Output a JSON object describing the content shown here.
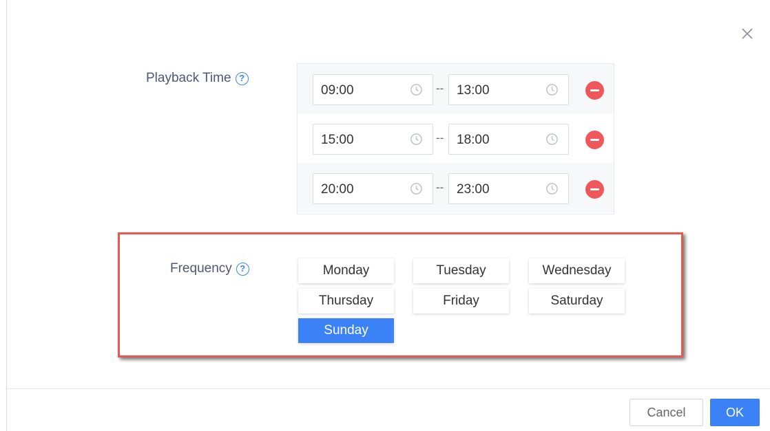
{
  "playback": {
    "label": "Playback Time",
    "separator": "--",
    "rows": [
      {
        "start": "09:00",
        "end": "13:00"
      },
      {
        "start": "15:00",
        "end": "18:00"
      },
      {
        "start": "20:00",
        "end": "23:00"
      }
    ]
  },
  "frequency": {
    "label": "Frequency",
    "days": [
      "Monday",
      "Tuesday",
      "Wednesday",
      "Thursday",
      "Friday",
      "Saturday",
      "Sunday"
    ],
    "selected": "Sunday"
  },
  "footer": {
    "cancel_label": "Cancel",
    "ok_label": "OK"
  },
  "colors": {
    "accent": "#3b82f6",
    "remove": "#f0575b",
    "highlight_border": "#e8594b"
  }
}
